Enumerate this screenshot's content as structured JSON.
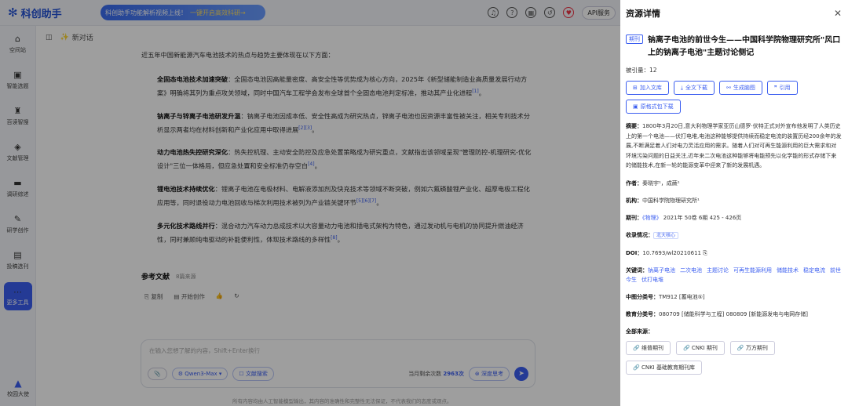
{
  "app": {
    "name": "科创助手",
    "banner": "科创助手功能解析视频上线！",
    "banner_hl": "一键开启高效科研→",
    "api": "API服务"
  },
  "sidebar": {
    "items": [
      {
        "label": "空间站",
        "icon": "⌂"
      },
      {
        "label": "智能选题",
        "icon": "▣"
      },
      {
        "label": "百读智搜",
        "icon": "♜"
      },
      {
        "label": "文献管理",
        "icon": "◈"
      },
      {
        "label": "调研综述",
        "icon": "▬"
      },
      {
        "label": "研学创作",
        "icon": "✎"
      },
      {
        "label": "投稿选刊",
        "icon": "▤"
      },
      {
        "label": "更多工具",
        "icon": "⋯"
      }
    ],
    "bottom": "校园大使"
  },
  "main": {
    "new_chat": "新对话",
    "intro": "近五年中国新能源汽车电池技术的热点与趋势主要体现在以下方面：",
    "paras": [
      {
        "title": "全固态电池技术加速突破",
        "text": "：全固态电池因高能量密度、高安全性等优势成为核心方向，2025年《新型储能制造业高质量发展行动方案》明确将其列为重点攻关领域，同时中国汽车工程学会发布全球首个全固态电池判定标准，推动其产业化进程",
        "ref": "[1]",
        "tail": "。"
      },
      {
        "title": "钠离子与锌离子电池研发升温",
        "text": "：钠离子电池因成本低、安全性高成为研究热点，锌离子电池也因资源丰富性被关注，相关专利技术分析显示两者均在材料创新和产业化应用中取得进展",
        "ref": "[2][3]",
        "tail": "。"
      },
      {
        "title": "动力电池热失控研究深化",
        "text": "：热失控机理、主动安全防控及应急处置策略成为研究重点，文献指出该领域呈现\"管理防控-机理研究-优化设计\"三位一体格局，但应急处置和安全标准仍存空白",
        "ref": "[4]",
        "tail": "。"
      },
      {
        "title": "锂电池技术持续优化",
        "text": "：锂离子电池在电极材料、电解液添加剂及快充技术等领域不断突破，例如六氟磷酸锂产业化、超厚电极工程化应用等，同时退役动力电池回收与梯次利用技术被列为产业链关键环节",
        "ref": "[5][6][7]",
        "tail": "。"
      },
      {
        "title": "多元化技术路线并行",
        "text": "：混合动力汽车动力总成技术以大容量动力电池和插电式架构为特色，通过发动机与电机的协同提升燃油经济性，同时兼顾纯电驱动的补能便利性，体现技术路线的多样性",
        "ref": "[8]",
        "tail": "。"
      }
    ],
    "refs_title": "参考文献",
    "refs_count": "8篇来源",
    "actions": [
      "复制",
      "开始创作"
    ],
    "input_placeholder": "在输入您想了解的内容，Shift+Enter换行",
    "model": "Qwen3-Max",
    "search_btn": "文献搜索",
    "remain_label": "当月剩余次数",
    "remain_num": "2963次",
    "deep": "深度思考",
    "footnote": "所有内容均由人工智能模型输出，其内容的准确性和完整性无法保证，不代表我们的态度或观点。"
  },
  "panel": {
    "title": "资源详情",
    "tag": "期刊",
    "paper_title": "钠离子电池的前世今生——中国科学院物理研究所\"风口上的钠离子电池\"主题讨论侧记",
    "cited_label": "被引量：",
    "cited": "12",
    "buttons": [
      "加入文库",
      "全文下载",
      "生成脑图",
      "引用"
    ],
    "btn2": "原格式包下载",
    "abstract_label": "摘要：",
    "abstract": "1800年3月20日,意大利物理学家亚历山德罗·伏特正式对外宣布他发明了人类历史上的第一个电池——伏打电堆,电池这种能够提供持续而稳定电流的装置历经200余年的发展,不断满足着人们对电力灵活应用的需求。随着人们对可再生能源利用的巨大需求和对环境污染问题的日益关注,近年来二次电池这种能够将电能预先以化学能的形式存储下来的储能技术,在新一轮的能源变革中迎来了新的发展机遇。",
    "author_label": "作者：",
    "authors": "秦晓宇¹，成蕨¹",
    "org_label": "机构：",
    "org": "中国科学院物理研究所¹",
    "period_label": "期刊：",
    "journal": "《物理》",
    "period": "2021年 50卷 6期 425 - 426页",
    "index_label": "收录情况：",
    "index": "北大核心",
    "doi_label": "DOI：",
    "doi": "10.7693/wl20210611",
    "kw_label": "关键词：",
    "keywords": [
      "钠离子电池",
      "二次电池",
      "主题讨论",
      "可再生能源利用",
      "储能技术",
      "稳定电流",
      "前世今生",
      "伏打电堆"
    ],
    "clc_label": "中图分类号：",
    "clc": "TM912 [蓄电池⑤]",
    "edu_label": "教育分类号：",
    "edu": "080709 [储能科学与工程]  080809 [新能源发电与电网存储]",
    "src_label": "全部来源：",
    "sources": [
      "维普期刊",
      "CNKI 期刊",
      "万方期刊",
      "CNKI 基础教育期刊库"
    ]
  }
}
